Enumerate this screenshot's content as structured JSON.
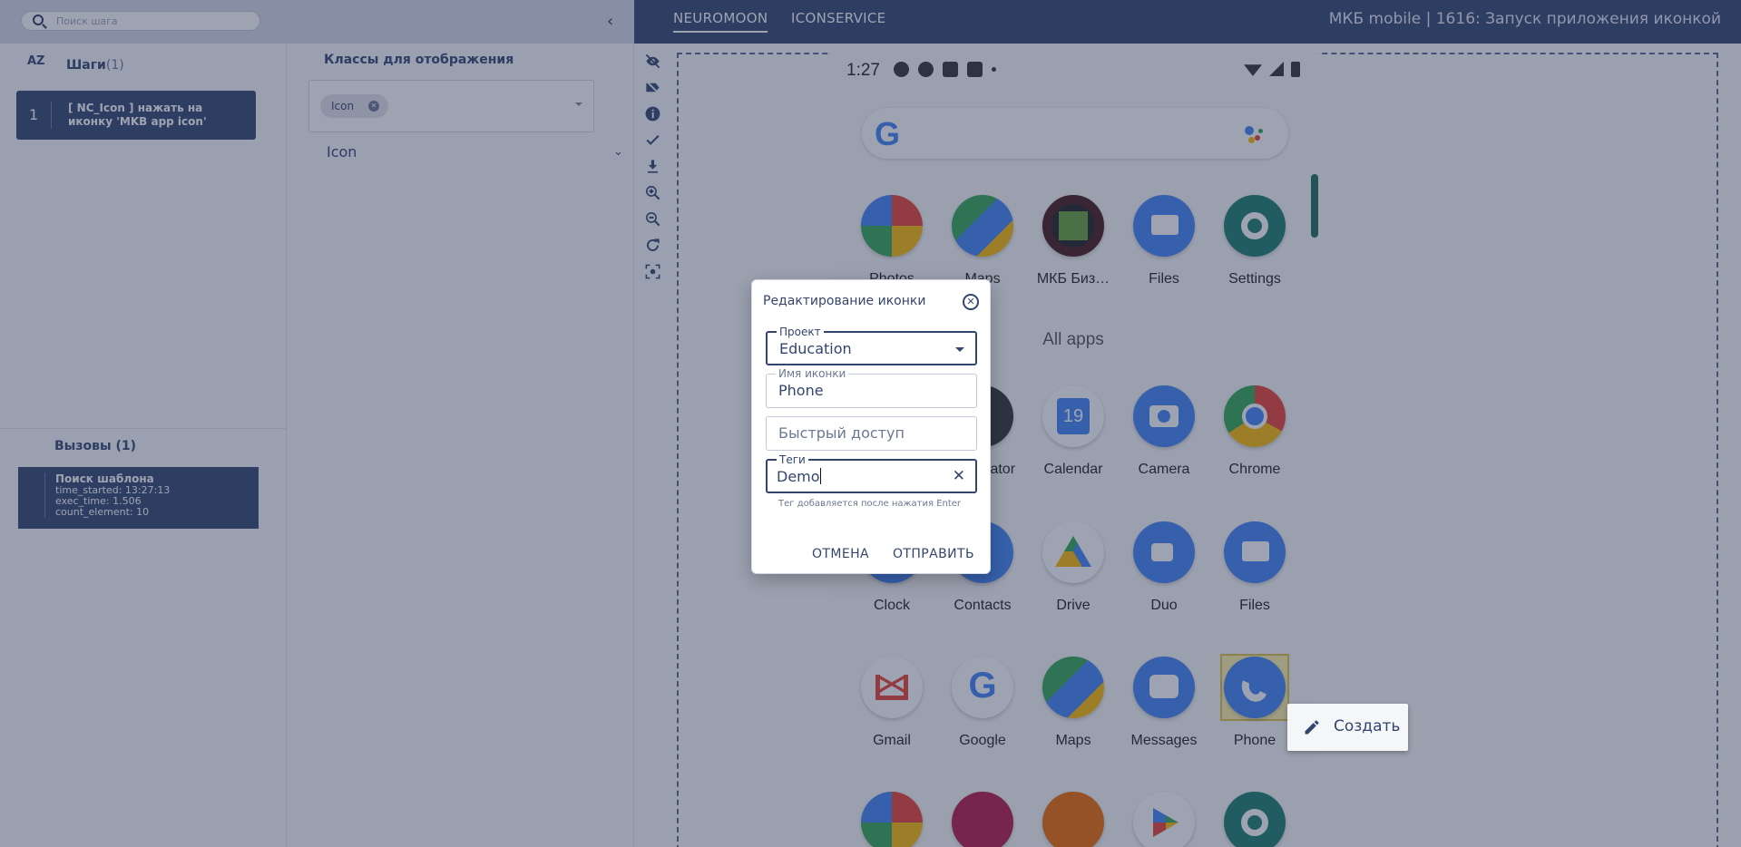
{
  "header": {
    "search_placeholder": "Поиск шага",
    "tabs": [
      "NEUROMOON",
      "ICONSERVICE"
    ],
    "app_title": "МКБ mobile | 1616: Запуск приложения иконкой"
  },
  "steps": {
    "sort_label": "AZ",
    "title": "Шаги",
    "count": "(1)",
    "items": [
      {
        "number": "1",
        "text": "[ NC_Icon ] нажать на иконку 'MKB app icon'"
      }
    ]
  },
  "calls": {
    "title": "Вызовы (1)",
    "items": [
      {
        "title": "Поиск шаблона",
        "time_started": "time_started: 13:27:13",
        "exec_time": "exec_time: 1.506",
        "count_element": "count_element: 10"
      }
    ]
  },
  "classes": {
    "title": "Классы для отображения",
    "chips": [
      "Icon"
    ],
    "rows": [
      "Icon"
    ]
  },
  "toolbar": {
    "icons": [
      "eye-off-icon",
      "label-off-icon",
      "info-icon",
      "check-icon",
      "download-icon",
      "zoom-in-icon",
      "zoom-out-icon",
      "refresh-icon",
      "focus-icon"
    ]
  },
  "phone": {
    "time": "1:27",
    "all_apps_label": "All apps",
    "row1": [
      "Photos",
      "Maps",
      "МКБ Биз…",
      "Files",
      "Settings"
    ],
    "row2": [
      "Calculator",
      "Calendar",
      "Camera",
      "Chrome"
    ],
    "calendar_day": "19",
    "row3": [
      "Clock",
      "Contacts",
      "Drive",
      "Duo",
      "Files"
    ],
    "row4": [
      "Gmail",
      "Google",
      "Maps",
      "Messages",
      "Phone"
    ]
  },
  "context_menu": {
    "create_label": "Создать"
  },
  "dialog": {
    "title": "Редактирование иконки",
    "project": {
      "label": "Проект",
      "value": "Education"
    },
    "icon_name": {
      "label": "Имя иконки",
      "value": "Phone"
    },
    "quick_access": {
      "placeholder": "Быстрый доступ"
    },
    "tags": {
      "label": "Теги",
      "value": "Demo"
    },
    "hint": "Тег добавляется после нажатия Enter",
    "cancel_label": "ОТМЕНА",
    "submit_label": "ОТПРАВИТЬ"
  },
  "colors": {
    "primary": "#34456d",
    "header_bg": "#34456d",
    "accent_green": "#1c6d5e"
  }
}
